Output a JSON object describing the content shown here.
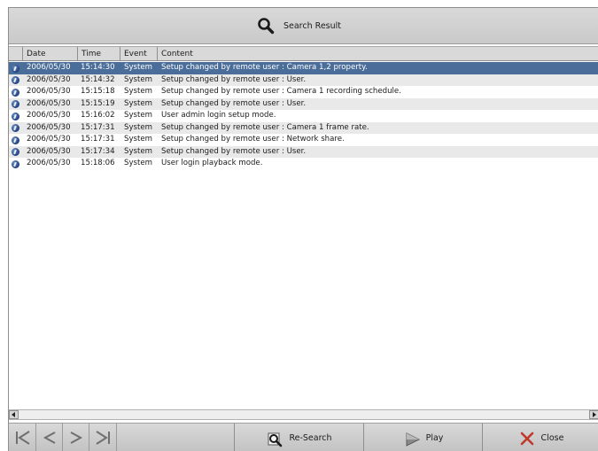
{
  "window": {
    "title": "Search Result",
    "title_icon": "magnifier-icon"
  },
  "table": {
    "columns": [
      "Date",
      "Time",
      "Event",
      "Content"
    ],
    "rows": [
      {
        "date": "2006/05/30",
        "time": "15:14:30",
        "event": "System",
        "content": "Setup changed by remote user : Camera 1,2 property.",
        "selected": true
      },
      {
        "date": "2006/05/30",
        "time": "15:14:32",
        "event": "System",
        "content": "Setup changed by remote user : User.",
        "selected": false
      },
      {
        "date": "2006/05/30",
        "time": "15:15:18",
        "event": "System",
        "content": "Setup changed by remote user : Camera 1 recording schedule.",
        "selected": false
      },
      {
        "date": "2006/05/30",
        "time": "15:15:19",
        "event": "System",
        "content": "Setup changed by remote user : User.",
        "selected": false
      },
      {
        "date": "2006/05/30",
        "time": "15:16:02",
        "event": "System",
        "content": "User admin login setup mode.",
        "selected": false
      },
      {
        "date": "2006/05/30",
        "time": "15:17:31",
        "event": "System",
        "content": "Setup changed by remote user : Camera 1 frame rate.",
        "selected": false
      },
      {
        "date": "2006/05/30",
        "time": "15:17:31",
        "event": "System",
        "content": "Setup changed by remote user : Network share.",
        "selected": false
      },
      {
        "date": "2006/05/30",
        "time": "15:17:34",
        "event": "System",
        "content": "Setup changed by remote user : User.",
        "selected": false
      },
      {
        "date": "2006/05/30",
        "time": "15:18:06",
        "event": "System",
        "content": "User  login playback mode.",
        "selected": false
      }
    ],
    "row_icon": "info-icon"
  },
  "navigation": {
    "icons": [
      "first-page-icon",
      "previous-page-icon",
      "next-page-icon",
      "last-page-icon"
    ]
  },
  "actions": {
    "research_label": "Re-Search",
    "play_label": "Play",
    "close_label": "Close"
  },
  "colors": {
    "selected_row": "#4a6e99",
    "alt_row": "#e9e9e9",
    "toolbar": "#d0d0d0",
    "close_x": "#c0392b"
  }
}
